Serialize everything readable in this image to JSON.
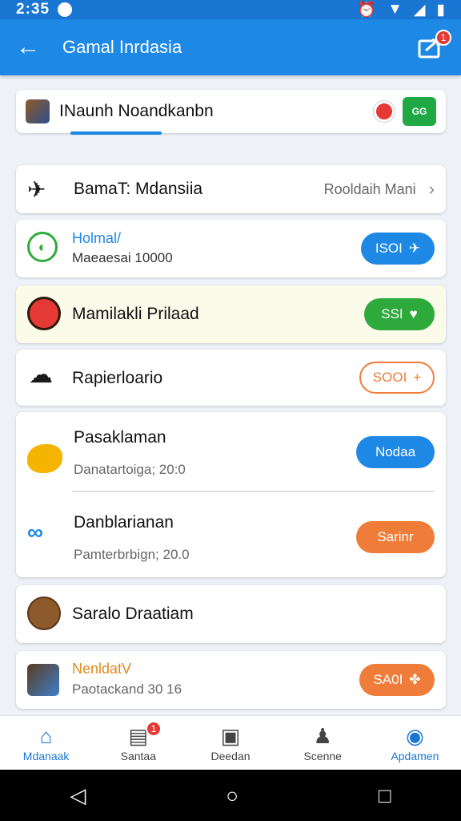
{
  "status": {
    "time": "2:35"
  },
  "appbar": {
    "title": "Gamal Inrdasia",
    "badge": "1"
  },
  "tabcard": {
    "title": "INaunh Noandkanbn"
  },
  "rows": {
    "r1": {
      "title": "BamaT: Mdansiia",
      "right": "Rooldaih Mani"
    },
    "r2": {
      "title": "Holmal/",
      "sub": "Maeaesai 10000",
      "btn": "ISOI"
    },
    "r3": {
      "title": "Mamilakli Prilaad",
      "btn": "SSI"
    },
    "r4": {
      "title": "Rapierloario",
      "btn": "SOOI"
    },
    "r5a": {
      "title": "Pasaklaman",
      "sub": "Danatartoiga; 20:0",
      "btn": "Nodaa"
    },
    "r5b": {
      "title": "Danblarianan",
      "sub": "Pamterbrbign; 20.0",
      "btn": "Sarinr"
    },
    "r6": {
      "title": "Saralo Draatiam"
    },
    "r7": {
      "title": "NenldatV",
      "sub": "Paotackand 30 16",
      "btn": "SA0I"
    }
  },
  "nav": {
    "items": [
      "Mdanaak",
      "Santaa",
      "Deedan",
      "Scenne",
      "Apdamen"
    ],
    "badge": "1"
  },
  "colors": {
    "primary": "#1e88e5",
    "green": "#2eaa3c",
    "orange": "#f07c3a",
    "blue": "#1e88e5"
  }
}
